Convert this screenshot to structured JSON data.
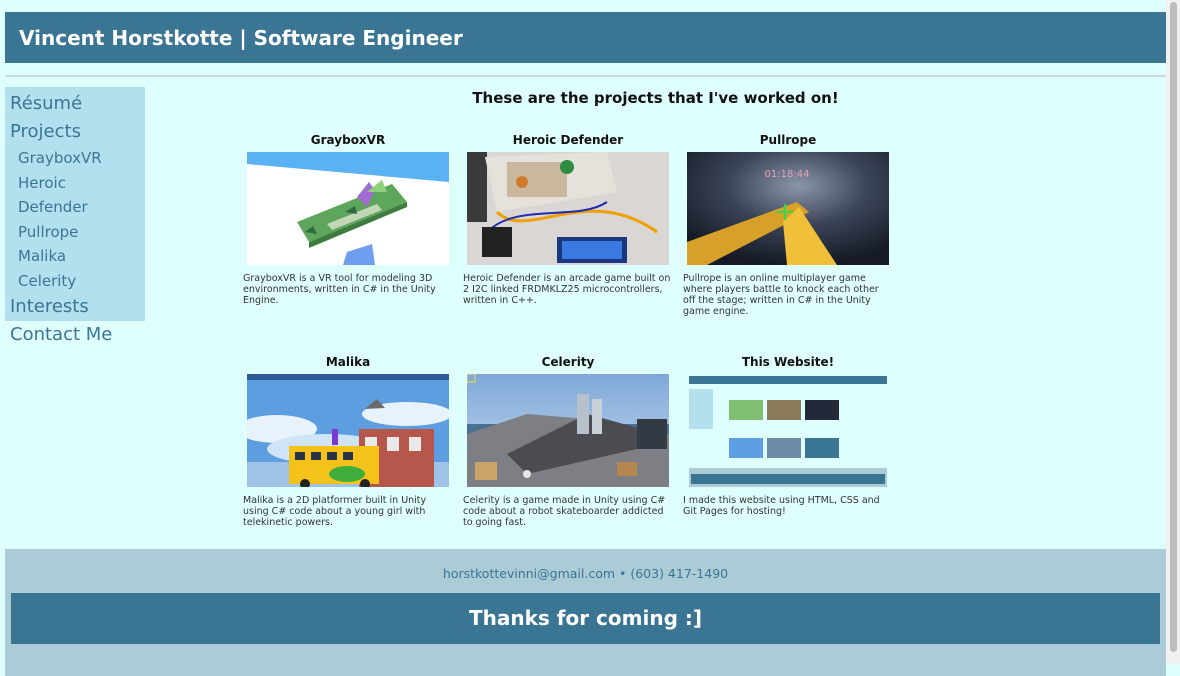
{
  "header": {
    "title": "Vincent Horstkotte | Software Engineer"
  },
  "sidebar": {
    "items": [
      {
        "label": "Résumé"
      },
      {
        "label": "Projects"
      },
      {
        "label": "GrayboxVR"
      },
      {
        "label": "Heroic Defender"
      },
      {
        "label": "Pullrope"
      },
      {
        "label": "Malika"
      },
      {
        "label": "Celerity"
      },
      {
        "label": "Interests"
      },
      {
        "label": "Contact Me"
      }
    ]
  },
  "main": {
    "title": "These are the projects that I've worked on!",
    "projects": [
      {
        "name": "GrayboxVR",
        "desc": "GrayboxVR is a VR tool for modeling 3D environments, written in C# in the Unity Engine."
      },
      {
        "name": "Heroic Defender",
        "desc": "Heroic Defender is an arcade game built on 2 I2C linked FRDMKLZ25 microcontrollers, written in C++."
      },
      {
        "name": "Pullrope",
        "desc": "Pullrope is an online multiplayer game where players battle to knock each other off the stage; written in C# in the Unity game engine."
      },
      {
        "name": "Malika",
        "desc": "Malika is a 2D platformer built in Unity using C# code about a young girl with telekinetic powers."
      },
      {
        "name": "Celerity",
        "desc": "Celerity is a game made in Unity using C# code about a robot skateboarder addicted to going fast."
      },
      {
        "name": "This Website!",
        "desc": "I made this website using HTML, CSS and Git Pages for hosting!"
      }
    ],
    "pullrope_timer": "01:18:44"
  },
  "footer": {
    "contact": "horstkottevinni@gmail.com • (603) 417-1490",
    "thanks": "Thanks for coming :]"
  }
}
